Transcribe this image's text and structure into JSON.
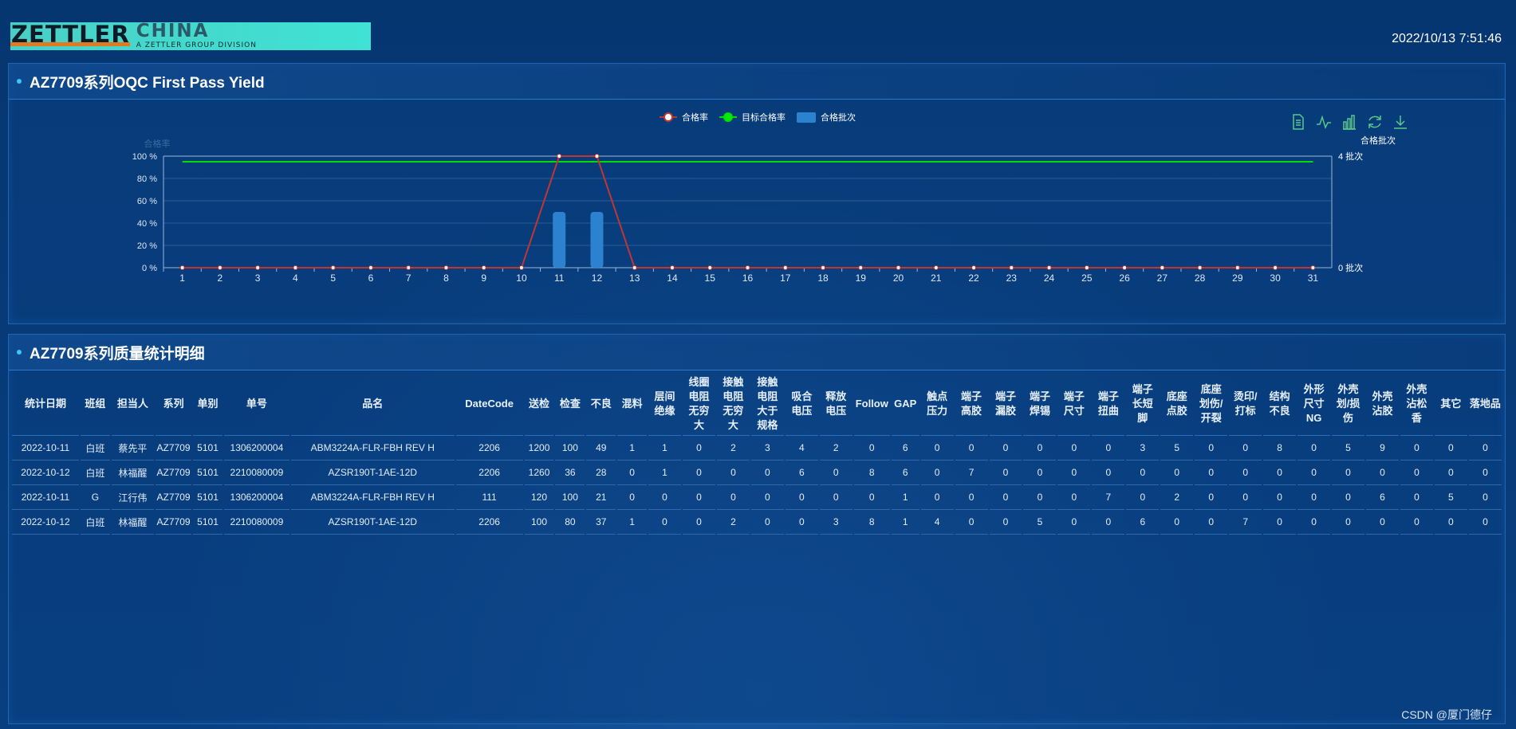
{
  "header": {
    "brand": "ZETTLER",
    "brand_suffix": "CHINA",
    "division": "A ZETTLER GROUP DIVISION",
    "datetime": "2022/10/13 7:51:46"
  },
  "chart_panel": {
    "title": "AZ7709系列OQC First Pass Yield",
    "legend": [
      "合格率",
      "目标合格率",
      "合格批次"
    ],
    "toolbar": {
      "icons": [
        "data-view-icon",
        "line-chart-icon",
        "bar-chart-icon",
        "refresh-icon",
        "download-icon"
      ],
      "active_label": "合格批次"
    }
  },
  "chart_data": {
    "type": "bar+line",
    "x": [
      1,
      2,
      3,
      4,
      5,
      6,
      7,
      8,
      9,
      10,
      11,
      12,
      13,
      14,
      15,
      16,
      17,
      18,
      19,
      20,
      21,
      22,
      23,
      24,
      25,
      26,
      27,
      28,
      29,
      30,
      31
    ],
    "y_left_name": "合格率",
    "y_left_ticks": [
      "0 %",
      "20 %",
      "40 %",
      "60 %",
      "80 %",
      "100 %"
    ],
    "y_left_range": [
      0,
      100
    ],
    "y_right_ticks": [
      "0 批次",
      "4 批次"
    ],
    "y_right_range": [
      0,
      4
    ],
    "grid": true,
    "legend_position": "top-center",
    "colors": {
      "yield": "#c23531",
      "target": "#00dd00",
      "batches": "#2d82cf"
    },
    "series": [
      {
        "name": "合格率",
        "kind": "line",
        "axis": "left",
        "values": [
          0,
          0,
          0,
          0,
          0,
          0,
          0,
          0,
          0,
          0,
          100,
          100,
          0,
          0,
          0,
          0,
          0,
          0,
          0,
          0,
          0,
          0,
          0,
          0,
          0,
          0,
          0,
          0,
          0,
          0,
          0
        ]
      },
      {
        "name": "目标合格率",
        "kind": "line",
        "axis": "left",
        "values": [
          95,
          95,
          95,
          95,
          95,
          95,
          95,
          95,
          95,
          95,
          95,
          95,
          95,
          95,
          95,
          95,
          95,
          95,
          95,
          95,
          95,
          95,
          95,
          95,
          95,
          95,
          95,
          95,
          95,
          95,
          95
        ]
      },
      {
        "name": "合格批次",
        "kind": "bar",
        "axis": "right",
        "values": [
          0,
          0,
          0,
          0,
          0,
          0,
          0,
          0,
          0,
          0,
          2,
          2,
          0,
          0,
          0,
          0,
          0,
          0,
          0,
          0,
          0,
          0,
          0,
          0,
          0,
          0,
          0,
          0,
          0,
          0,
          0
        ]
      }
    ]
  },
  "table_panel": {
    "title": "AZ7709系列质量统计明细",
    "columns": [
      "统计日期",
      "班组",
      "担当人",
      "系列",
      "单别",
      "单号",
      "品名",
      "DateCode",
      "送检",
      "检查",
      "不良",
      "混料",
      "层间绝缘",
      "线圈电阻无穷大",
      "接触电阻无穷大",
      "接触电阻大于规格",
      "吸合电压",
      "释放电压",
      "Follow",
      "GAP",
      "触点压力",
      "端子高胶",
      "端子漏胶",
      "端子焊锡",
      "端子尺寸",
      "端子扭曲",
      "端子长短脚",
      "底座点胶",
      "底座划伤/开裂",
      "烫印/打标",
      "结构不良",
      "外形尺寸NG",
      "外壳划/损伤",
      "外壳沾胶",
      "外壳沾松香",
      "其它",
      "落地品"
    ],
    "rows": [
      [
        "2022-10-11",
        "白班",
        "蔡先平",
        "AZ7709",
        "5101",
        "1306200004",
        "ABM3224A-FLR-FBH REV H",
        "2206",
        "1200",
        "100",
        "49",
        "1",
        "1",
        "0",
        "2",
        "3",
        "4",
        "2",
        "0",
        "6",
        "0",
        "0",
        "0",
        "0",
        "0",
        "0",
        "3",
        "5",
        "0",
        "0",
        "8",
        "0",
        "5",
        "9",
        "0",
        "0",
        "0"
      ],
      [
        "2022-10-12",
        "白班",
        "林福醒",
        "AZ7709",
        "5101",
        "2210080009",
        "AZSR190T-1AE-12D",
        "2206",
        "1260",
        "36",
        "28",
        "0",
        "1",
        "0",
        "0",
        "0",
        "6",
        "0",
        "8",
        "6",
        "0",
        "7",
        "0",
        "0",
        "0",
        "0",
        "0",
        "0",
        "0",
        "0",
        "0",
        "0",
        "0",
        "0",
        "0",
        "0",
        "0"
      ],
      [
        "2022-10-11",
        "G",
        "江行伟",
        "AZ7709",
        "5101",
        "1306200004",
        "ABM3224A-FLR-FBH REV H",
        "111",
        "120",
        "100",
        "21",
        "0",
        "0",
        "0",
        "0",
        "0",
        "0",
        "0",
        "0",
        "1",
        "0",
        "0",
        "0",
        "0",
        "0",
        "7",
        "0",
        "2",
        "0",
        "0",
        "0",
        "0",
        "0",
        "6",
        "0",
        "5",
        "0"
      ],
      [
        "2022-10-12",
        "白班",
        "林福醒",
        "AZ7709",
        "5101",
        "2210080009",
        "AZSR190T-1AE-12D",
        "2206",
        "100",
        "80",
        "37",
        "1",
        "0",
        "0",
        "2",
        "0",
        "0",
        "3",
        "8",
        "1",
        "4",
        "0",
        "0",
        "5",
        "0",
        "0",
        "6",
        "0",
        "0",
        "7",
        "0",
        "0",
        "0",
        "0",
        "0",
        "0",
        "0"
      ]
    ]
  },
  "watermark": "CSDN @厦门德仔"
}
